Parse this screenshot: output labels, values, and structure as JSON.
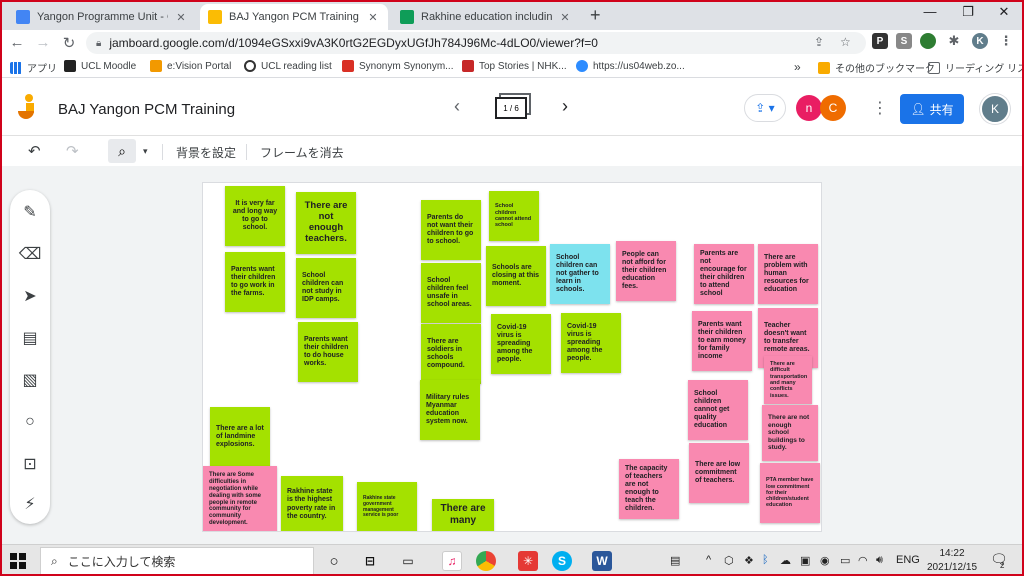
{
  "browser": {
    "tabs": [
      {
        "title": "Yangon Programme Unit - Goog",
        "icon": "google-doc-icon",
        "active": false
      },
      {
        "title": "BAJ Yangon PCM Training - Goo",
        "icon": "jamboard-icon",
        "active": true
      },
      {
        "title": "Rakhine education including DRM",
        "icon": "google-sheets-icon",
        "active": false
      }
    ],
    "url": "jamboard.google.com/d/1094eGSxxi9vA3K0rtG2EGDyxUGfJh784J96Mc-4dLO0/viewer?f=0",
    "profile_initial": "K",
    "bookmarks": [
      {
        "label": "アプリ",
        "icon": "apps-grid-icon"
      },
      {
        "label": "UCL Moodle",
        "icon": "ucl-icon"
      },
      {
        "label": "e:Vision Portal",
        "icon": "evision-icon"
      },
      {
        "label": "UCL reading list",
        "icon": "reading-list-icon"
      },
      {
        "label": "Synonym Synonym...",
        "icon": "thesaurus-icon"
      },
      {
        "label": "Top Stories | NHK...",
        "icon": "nhk-icon"
      },
      {
        "label": "https://us04web.zo...",
        "icon": "zoom-icon"
      }
    ],
    "bookmarks_overflow": "»",
    "other_bookmarks": "その他のブックマーク",
    "reading_list": "リーディング リスト"
  },
  "jamboard": {
    "title": "BAJ Yangon PCM Training",
    "frame_counter": "1 / 6",
    "collaborators": [
      "n",
      "C"
    ],
    "share_label": "共有",
    "user_initial": "K",
    "set_background": "背景を設定",
    "clear_frame": "フレームを消去"
  },
  "colors": {
    "green": "#a4e100",
    "pink": "#f989b0",
    "cyan": "#7de2ee",
    "brand_blue": "#1a73e8"
  },
  "sticky_notes": [
    {
      "text": "It is very far and long way to go to school.",
      "color": "green"
    },
    {
      "text": "There are not enough teachers.",
      "color": "green"
    },
    {
      "text": "Parents want their children to go work in the farms.",
      "color": "green"
    },
    {
      "text": "School children can not study in IDP camps.",
      "color": "green"
    },
    {
      "text": "Parents want their children to do house works.",
      "color": "green"
    },
    {
      "text": "Parents do not want their children to go to school.",
      "color": "green"
    },
    {
      "text": "School children cannot attend school",
      "color": "green"
    },
    {
      "text": "School children feel unsafe in school areas.",
      "color": "green"
    },
    {
      "text": "Schools are closing at this moment.",
      "color": "green"
    },
    {
      "text": "School children can not gather to learn in schools.",
      "color": "cyan"
    },
    {
      "text": "People can not afford for their children education fees.",
      "color": "pink"
    },
    {
      "text": "Parents are not encourage for their children to attend school",
      "color": "pink"
    },
    {
      "text": "There are problem with human resources for education",
      "color": "pink"
    },
    {
      "text": "There are soldiers in schools compound.",
      "color": "green"
    },
    {
      "text": "Covid-19 virus is spreading among the people.",
      "color": "green"
    },
    {
      "text": "Covid-19 virus is spreading among the people.",
      "color": "green"
    },
    {
      "text": "Parents want their children to earn money for family income",
      "color": "pink"
    },
    {
      "text": "Teacher doesn't want to transfer remote areas.",
      "color": "pink"
    },
    {
      "text": "There are difficult transportation and many conflicts issues.",
      "color": "pink"
    },
    {
      "text": "Military rules Myanmar education system now.",
      "color": "green"
    },
    {
      "text": "School children cannot get quality education",
      "color": "pink"
    },
    {
      "text": "There are not enough school buildings to study.",
      "color": "pink"
    },
    {
      "text": "There are a lot of landmine explosions.",
      "color": "green"
    },
    {
      "text": "There are low commitment of teachers.",
      "color": "pink"
    },
    {
      "text": "The capacity of teachers are not enough to teach the children.",
      "color": "pink"
    },
    {
      "text": "PTA member have low commitment for their children/student education",
      "color": "pink"
    },
    {
      "text": "There are Some difficulties in negotiation while dealing with some people in remote community for community development.",
      "color": "pink"
    },
    {
      "text": "Rakhine state is the highest poverty rate in the country.",
      "color": "green"
    },
    {
      "text": "Rakhine state government management service is poor",
      "color": "green"
    },
    {
      "text": "There are many",
      "color": "green"
    }
  ],
  "taskbar": {
    "search_placeholder": "ここに入力して検索",
    "language": "ENG",
    "time": "14:22",
    "date": "2021/12/15",
    "notification_count": "2"
  }
}
